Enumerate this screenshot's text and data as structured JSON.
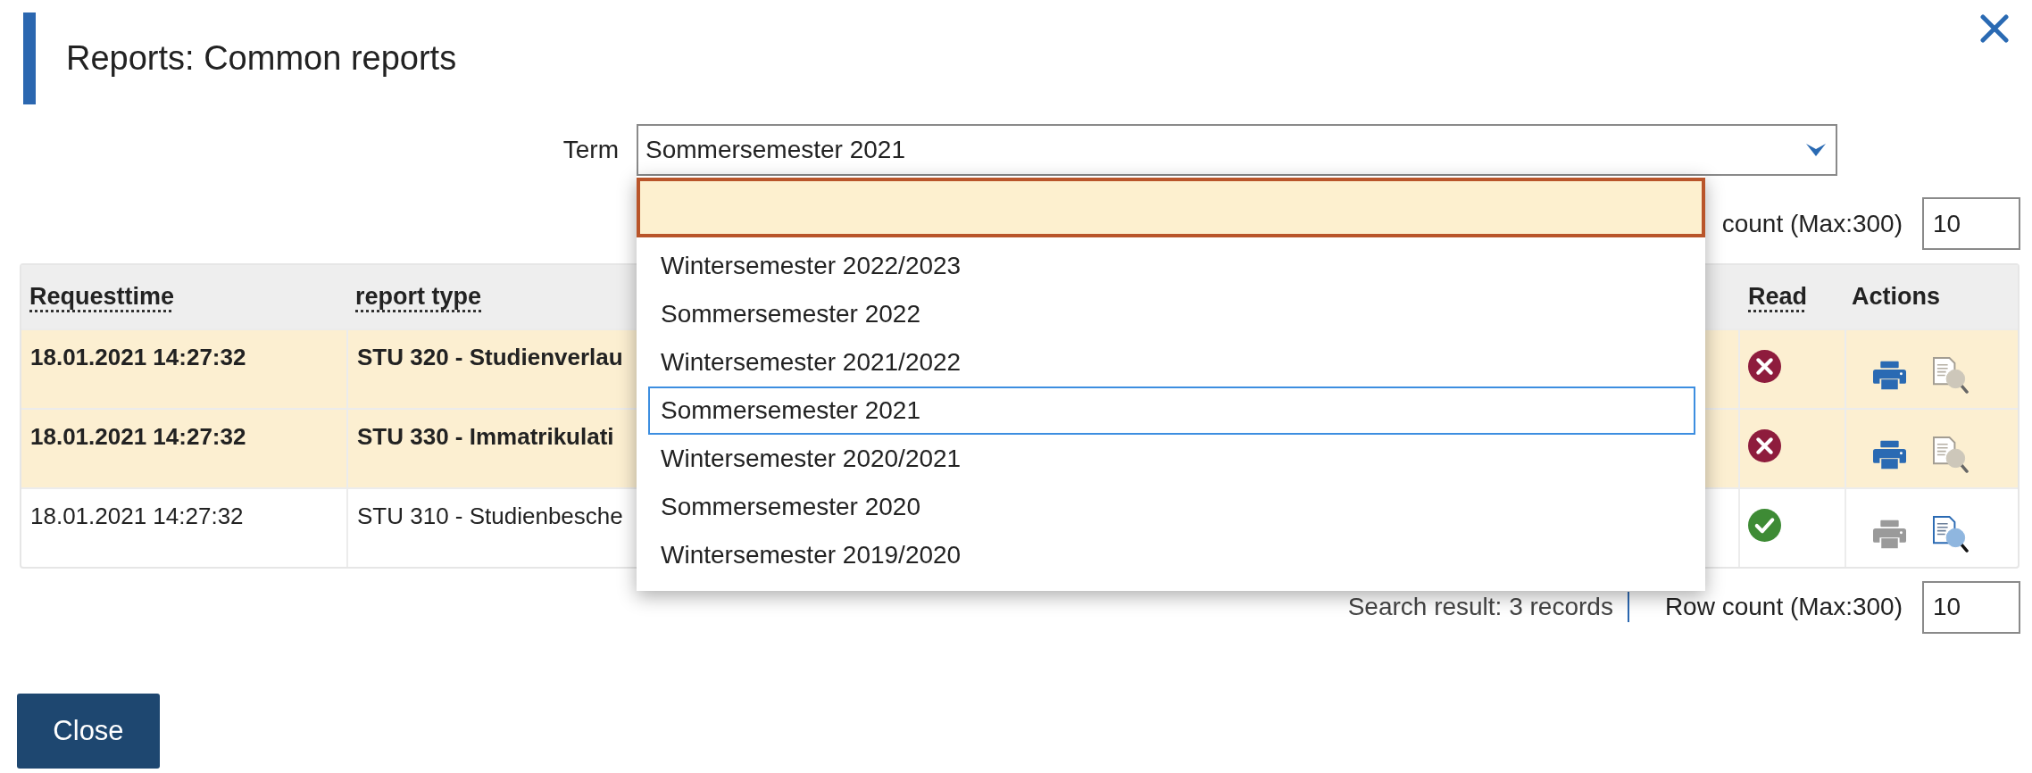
{
  "header": {
    "title": "Reports: Common reports"
  },
  "term_filter": {
    "label": "Term",
    "value": "Sommersemester 2021",
    "expanded": true,
    "options": [
      {
        "label": "Wintersemester 2022/2023",
        "selected": false
      },
      {
        "label": "Sommersemester 2022",
        "selected": false
      },
      {
        "label": "Wintersemester 2021/2022",
        "selected": false
      },
      {
        "label": "Sommersemester 2021",
        "selected": true
      },
      {
        "label": "Wintersemester 2020/2021",
        "selected": false
      },
      {
        "label": "Sommersemester 2020",
        "selected": false
      },
      {
        "label": "Wintersemester 2019/2020",
        "selected": false
      }
    ]
  },
  "row_count_top": {
    "label": "count (Max:300)",
    "value": "10"
  },
  "table": {
    "columns": [
      {
        "label": "Requesttime",
        "sortable": true
      },
      {
        "label": "report type",
        "sortable": true
      },
      {
        "label": "Read",
        "sortable": true
      },
      {
        "label": "Actions",
        "sortable": false
      }
    ],
    "rows": [
      {
        "requesttime": "18.01.2021 14:27:32",
        "report_type": "STU 320 - Studienverlau",
        "read": false,
        "print_enabled": true,
        "preview_enabled": false
      },
      {
        "requesttime": "18.01.2021 14:27:32",
        "report_type": "STU 330 - Immatrikulati",
        "read": false,
        "print_enabled": true,
        "preview_enabled": false
      },
      {
        "requesttime": "18.01.2021 14:27:32",
        "report_type": "STU 310 - Studienbesche",
        "read": true,
        "print_enabled": false,
        "preview_enabled": true
      }
    ]
  },
  "footer": {
    "search_result": "Search result: 3 records",
    "row_count": {
      "label": "Row count (Max:300)",
      "value": "10"
    }
  },
  "buttons": [
    {
      "label": "Close"
    }
  ]
}
